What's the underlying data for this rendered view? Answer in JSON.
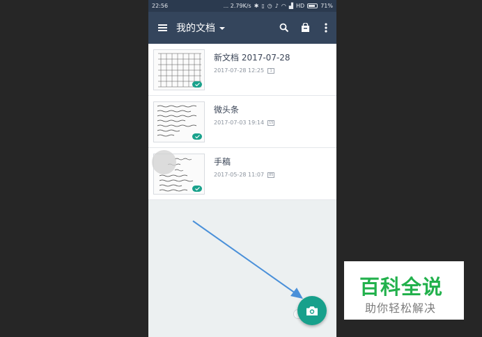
{
  "statusbar": {
    "time": "22:56",
    "network_speed": "... 2.79K/s",
    "carrier": "HD",
    "battery": "71%",
    "battery_level": 0.71
  },
  "appbar": {
    "title": "我的文档",
    "icons": [
      "menu-icon",
      "search-icon",
      "shopping-bag-icon",
      "more-vert-icon"
    ]
  },
  "documents": [
    {
      "title": "新文档 2017-07-28",
      "date": "2017-07-28 12:25",
      "pages": "1"
    },
    {
      "title": "微头条",
      "date": "2017-07-03 19:14",
      "pages": "15"
    },
    {
      "title": "手稿",
      "date": "2017-05-28 11:07",
      "pages": "85"
    }
  ],
  "fab": {
    "icon": "camera-icon"
  },
  "watermark": {
    "main": "百科全说",
    "sub": "助你轻松解决"
  },
  "colors": {
    "appbar": "#34455c",
    "statusbar": "#2b3a4f",
    "accent": "#17a08b",
    "arrow": "#4a90d9",
    "watermark_green": "#22b14c"
  }
}
